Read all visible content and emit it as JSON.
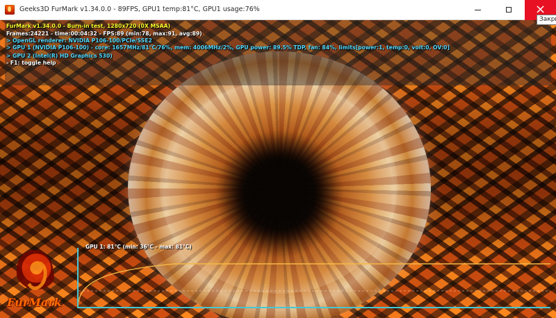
{
  "window": {
    "title": "Geeks3D FurMark v1.34.0.0 - 89FPS, GPU1 temp:81°C, GPU1 usage:76%",
    "tooltip": "Закрыть",
    "controls": {
      "minimize": "minimize",
      "maximize": "maximize",
      "close": "×"
    }
  },
  "hud": {
    "main": "FurMark v1.34.0.0 - Burn-in test, 1280x720 (0X MSAA)",
    "frames": "Frames:24221 - time:00:04:32 - FPS:89 (min:78, max:91, avg:89)",
    "opengl": "> OpenGL renderer: NVIDIA P106-100/PCIe/SSE2",
    "gpu1": "> GPU 1 (NVIDIA P106-100) - core: 1657MHz/81°C/76%, mem: 4006MHz/2%, GPU power: 89.5% TDP, fan: 84%, limits[power:1, temp:0, volt:0, OV:0]",
    "gpu2": "> GPU 2 (Intel(R) HD Graphics 530)",
    "help": "- F1: toggle help"
  },
  "graph": {
    "label": "GPU 1: 81°C (min: 36°C - max: 81°C)"
  },
  "logo": {
    "text": "FurMark"
  },
  "colors": {
    "titlebar_bg": "#ffffff",
    "close_red": "#e81123",
    "hud_yellow": "#ffff2e",
    "hud_cyan": "#54d9ff",
    "graph_cyan": "#45c8d5",
    "graph_orange": "#f5b845"
  }
}
